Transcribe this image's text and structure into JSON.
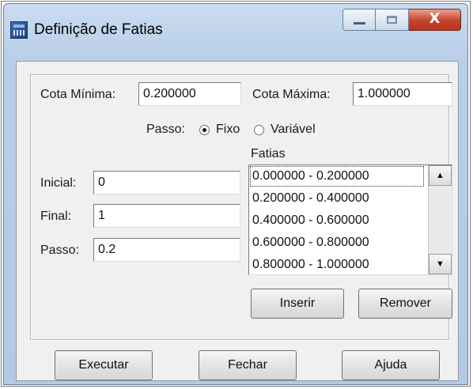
{
  "window": {
    "title": "Definição de Fatias",
    "icon": "dialog-icon",
    "caption_buttons": {
      "minimize": "minimize-icon",
      "maximize": "maximize-icon",
      "close_glyph": "X"
    }
  },
  "form": {
    "cota_minima_label": "Cota Mínima:",
    "cota_minima_value": "0.200000",
    "cota_maxima_label": "Cota Máxima:",
    "cota_maxima_value": "1.000000",
    "passo_type_label": "Passo:",
    "passo_fixo_label": "Fixo",
    "passo_variavel_label": "Variável",
    "passo_type_selected": "Fixo",
    "inicial_label": "Inicial:",
    "inicial_value": "0",
    "final_label": "Final:",
    "final_value": "1",
    "passo_label": "Passo:",
    "passo_value": "0.2",
    "fatias_label": "Fatias",
    "fatias_items": [
      "0.000000 - 0.200000",
      "0.200000 - 0.400000",
      "0.400000 - 0.600000",
      "0.600000 - 0.800000",
      "0.800000 - 1.000000"
    ],
    "fatias_selected_index": 0,
    "inserir_label": "Inserir",
    "remover_label": "Remover"
  },
  "footer": {
    "executar_label": "Executar",
    "fechar_label": "Fechar",
    "ajuda_label": "Ajuda"
  }
}
